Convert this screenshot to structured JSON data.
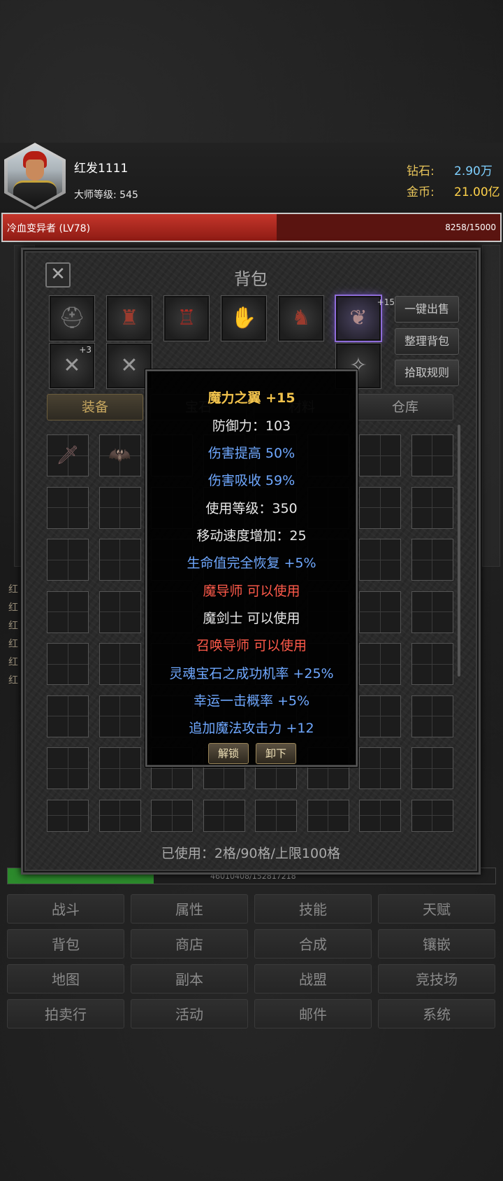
{
  "player": {
    "name": "红发1111",
    "master_level_label": "大师等级:",
    "master_level": "545"
  },
  "resources": {
    "diamond_label": "钻石:",
    "diamond_value": "2.90万",
    "gold_label": "金币:",
    "gold_value": "21.00亿"
  },
  "monster": {
    "name": "冷血变异者 (LV78)",
    "hp_text": "8258/15000",
    "hp_fraction": 0.5505
  },
  "bag": {
    "title": "背包",
    "close_label": "✕",
    "side_buttons": [
      "一键出售",
      "整理背包",
      "拾取规则"
    ],
    "tabs": [
      "装备",
      "宝石",
      "材料",
      "仓库"
    ],
    "slot_badges": {
      "wings": "+15",
      "weapon": "+3"
    },
    "used_text": "已使用：2格/90格/上限100格"
  },
  "tooltip": {
    "title": "魔力之翼 +15",
    "lines": [
      "防御力：103",
      "伤害提高 50%",
      "伤害吸收 59%",
      "使用等级：350",
      "移动速度增加：25",
      "生命值完全恢复 +5%",
      "魔导师 可以使用",
      "魔剑士 可以使用",
      "召唤导师 可以使用",
      "灵魂宝石之成功机率 +25%",
      "幸运一击概率 +5%",
      "追加魔法攻击力 +12"
    ],
    "unlock_label": "解锁",
    "unequip_label": "卸下"
  },
  "background": {
    "side_letters": [
      "红",
      "红",
      "红",
      "红",
      "红",
      "红"
    ],
    "exp_text": "46010408/152817218",
    "exp_fraction": 0.3
  },
  "nav": [
    "战斗",
    "属性",
    "技能",
    "天赋",
    "背包",
    "商店",
    "合成",
    "镶嵌",
    "地图",
    "副本",
    "战盟",
    "竞技场",
    "拍卖行",
    "活动",
    "邮件",
    "系统"
  ],
  "colors": {
    "title_gold": "#f2c34c",
    "stat_blue": "#6fa8ff",
    "class_red": "#ff5a4a",
    "hp_red": "#c5362b",
    "selected_purple": "#8e6cd8"
  }
}
